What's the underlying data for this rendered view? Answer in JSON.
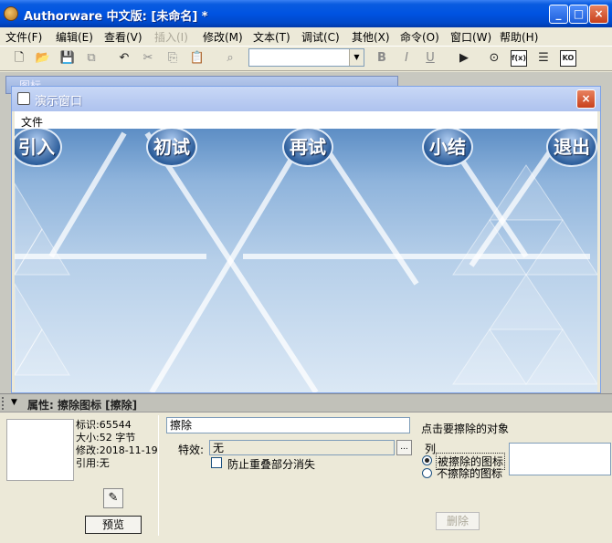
{
  "window": {
    "title": "Authorware 中文版: [未命名] *",
    "buttons": {
      "minimize": "_",
      "maximize": "□",
      "close": "×"
    }
  },
  "menu": [
    {
      "label": "文件(F)",
      "enabled": true
    },
    {
      "label": "编辑(E)",
      "enabled": true
    },
    {
      "label": "查看(V)",
      "enabled": true
    },
    {
      "label": "插入(I)",
      "enabled": false
    },
    {
      "label": "修改(M)",
      "enabled": true
    },
    {
      "label": "文本(T)",
      "enabled": true
    },
    {
      "label": "调试(C)",
      "enabled": true
    },
    {
      "label": "其他(X)",
      "enabled": true
    },
    {
      "label": "命令(O)",
      "enabled": true
    },
    {
      "label": "窗口(W)",
      "enabled": true
    },
    {
      "label": "帮助(H)",
      "enabled": true
    }
  ],
  "toolbar": {
    "icons": [
      "new-icon",
      "open-icon",
      "save-all-icon",
      "import-icon",
      "undo-icon",
      "cut-icon",
      "copy-icon",
      "paste-icon",
      "find-icon",
      "bold-icon",
      "italic-icon",
      "underline-icon",
      "run-icon",
      "control-panel-icon",
      "functions-icon",
      "variables-icon",
      "knowledge-objects-icon"
    ],
    "style_select_value": "",
    "bold_label": "B",
    "italic_label": "I",
    "underline_label": "U",
    "functions_label": "f(x)",
    "knowledge_label": "KO"
  },
  "icon_window": {
    "title": "图标"
  },
  "presentation": {
    "title": "演示窗口",
    "close": "×",
    "menu_file": "文件",
    "nav_buttons": [
      "引入",
      "初试",
      "再试",
      "小结",
      "退出"
    ]
  },
  "properties": {
    "header": "属性: 擦除图标 [擦除]",
    "info": {
      "id": "标识:65544",
      "size": "大小:52 字节",
      "modified": "修改:2018-11-19",
      "ref": "引用:无"
    },
    "preview_button": "预览",
    "name_value": "擦除",
    "effect_label": "特效:",
    "effect_value": "无",
    "effect_browse": "...",
    "prevent_overlap_label": "防止重叠部分消失",
    "click_hint": "点击要擦除的对象",
    "list_label": "列",
    "radio_erased": "被擦除的图标",
    "radio_not_erased": "不擦除的图标",
    "delete_button": "删除"
  },
  "colors": {
    "titlebar": "#0053e1",
    "stage_top": "#5d8ec5",
    "stage_bottom": "#dbe8f5"
  }
}
